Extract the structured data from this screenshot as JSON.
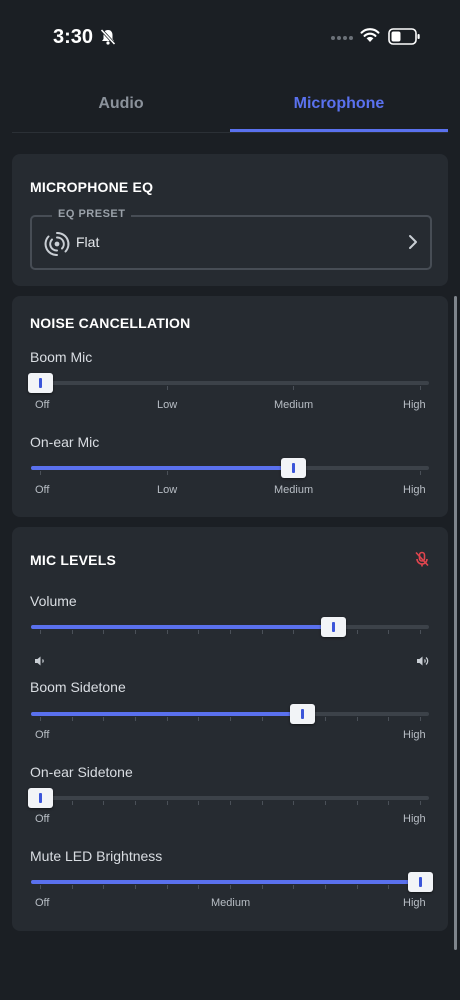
{
  "status": {
    "time": "3:30"
  },
  "tabs": [
    {
      "label": "Audio",
      "active": false
    },
    {
      "label": "Microphone",
      "active": true
    }
  ],
  "accent_color": "#5a71ee",
  "mute_icon_color": "#e0454e",
  "eq": {
    "title": "MICROPHONE EQ",
    "preset_label": "EQ PRESET",
    "preset_value": "Flat",
    "preset_icon": "signal-waves-icon"
  },
  "noise": {
    "title": "NOISE CANCELLATION",
    "sliders": [
      {
        "label": "Boom Mic",
        "value": "Off",
        "value_index": 0,
        "stops": [
          "Off",
          "Low",
          "Medium",
          "High"
        ]
      },
      {
        "label": "On-ear Mic",
        "value": "Medium",
        "value_index": 2,
        "stops": [
          "Off",
          "Low",
          "Medium",
          "High"
        ]
      }
    ]
  },
  "levels": {
    "title": "MIC LEVELS",
    "mute_icon": "mic-off-icon",
    "volume": {
      "label": "Volume",
      "value": 0.77,
      "icon_low": "volume-low-icon",
      "icon_high": "volume-high-icon"
    },
    "boom_sidetone": {
      "label": "Boom Sidetone",
      "value": 0.69,
      "min_label": "Off",
      "max_label": "High"
    },
    "onear_sidetone": {
      "label": "On-ear Sidetone",
      "value": 0.0,
      "min_label": "Off",
      "max_label": "High"
    },
    "mute_led": {
      "label": "Mute LED Brightness",
      "value": 1.0,
      "min_label": "Off",
      "mid_label": "Medium",
      "max_label": "High"
    }
  }
}
